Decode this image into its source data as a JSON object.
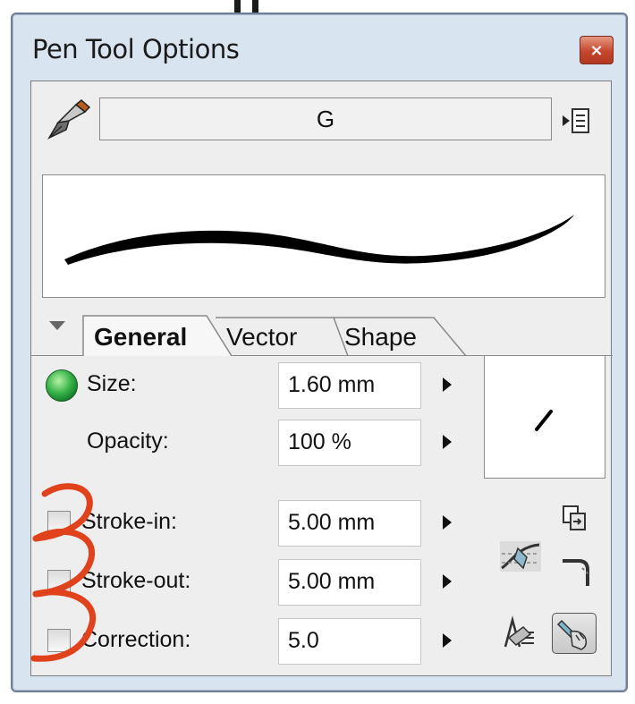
{
  "window": {
    "title": "Pen Tool Options",
    "close_label": "×"
  },
  "preset": {
    "name": "G"
  },
  "tabs": [
    {
      "label": "General",
      "active": true
    },
    {
      "label": "Vector",
      "active": false
    },
    {
      "label": "Shape",
      "active": false
    }
  ],
  "settings": {
    "size": {
      "label": "Size:",
      "value": "1.60 mm"
    },
    "opacity": {
      "label": "Opacity:",
      "value": "100 %"
    },
    "stroke_in": {
      "label": "Stroke-in:",
      "value": "5.00 mm",
      "checked": false
    },
    "stroke_out": {
      "label": "Stroke-out:",
      "value": "5.00 mm",
      "checked": false
    },
    "correction": {
      "label": "Correction:",
      "value": "5.0",
      "checked": false
    }
  },
  "colors": {
    "window_frame": "#d9e4f1",
    "close_button": "#c5462c",
    "status_led": "#39b54a",
    "annotation": "#e0421c"
  },
  "icons": [
    "pen-nib-icon",
    "preset-menu-icon",
    "stroke-curve-icon",
    "copy-settings-icon",
    "corner-icon",
    "pressure-icon",
    "stylus-icon"
  ]
}
